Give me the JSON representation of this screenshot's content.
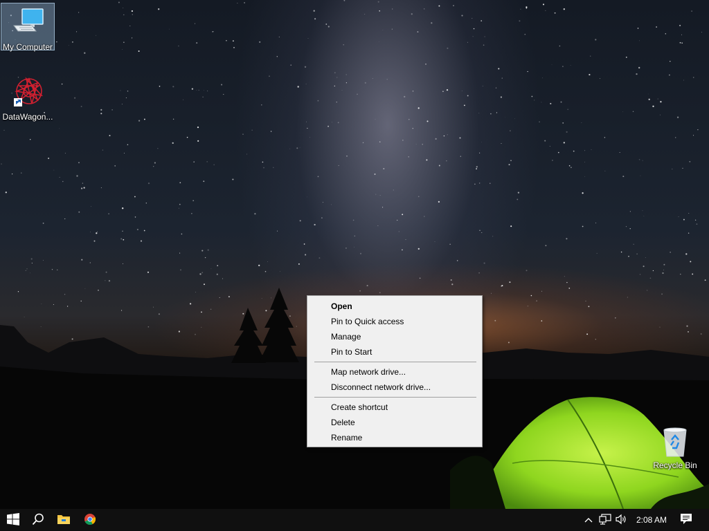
{
  "desktop": {
    "icons": [
      {
        "label": "My Computer",
        "icon": "computer-icon",
        "selected": true
      },
      {
        "label": "DataWagon...",
        "icon": "datawagon-shortcut-icon",
        "selected": false
      },
      {
        "label": "Recycle Bin",
        "icon": "recycle-bin-icon",
        "selected": false
      }
    ]
  },
  "context_menu": {
    "items": [
      {
        "label": "Open",
        "default": true
      },
      {
        "label": "Pin to Quick access"
      },
      {
        "label": "Manage"
      },
      {
        "label": "Pin to Start"
      },
      {
        "label": "Map network drive..."
      },
      {
        "label": "Disconnect network drive..."
      },
      {
        "label": "Create shortcut"
      },
      {
        "label": "Delete"
      },
      {
        "label": "Rename"
      }
    ]
  },
  "taskbar": {
    "start_icon": "windows-logo-icon",
    "search_icon": "search-icon",
    "pinned": [
      "file-explorer-icon",
      "chrome-icon"
    ],
    "tray": [
      "chevron-up-icon",
      "network-icon",
      "volume-icon"
    ],
    "clock": "2:08 AM",
    "notifications_icon": "action-center-icon"
  },
  "colors": {
    "taskbar_bg": "#101010",
    "menu_bg": "#f0f0f0",
    "menu_border": "#a0a0a0",
    "tent_green": "#9be22a"
  }
}
